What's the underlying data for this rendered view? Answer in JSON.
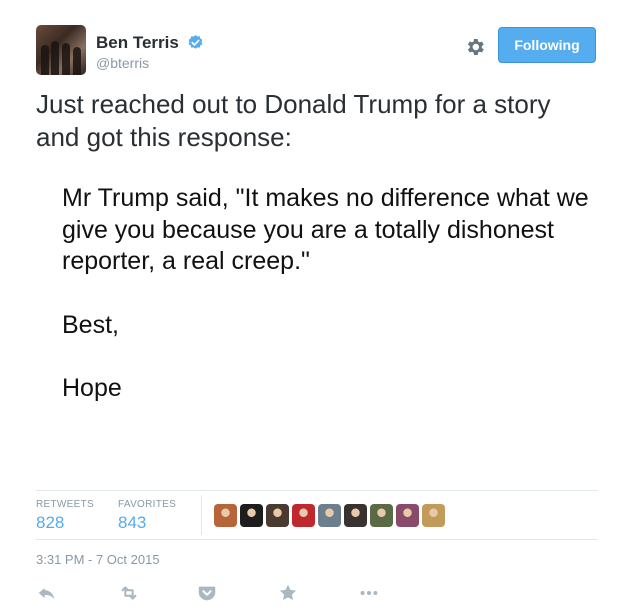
{
  "user": {
    "name": "Ben Terris",
    "handle": "@bterris",
    "verified": true
  },
  "follow_button": {
    "label": "Following",
    "color": "#55acee"
  },
  "tweet": {
    "text": "Just reached out to Donald Trump for a story and got this response:",
    "quote": {
      "line1": "Mr Trump said, \"It makes no difference what we give you because you are a totally dishonest reporter, a real creep.\"",
      "line2": "Best,",
      "line3": "Hope"
    }
  },
  "stats": {
    "retweets_label": "RETWEETS",
    "retweets_count": "828",
    "favorites_label": "FAVORITES",
    "favorites_count": "843"
  },
  "favoriter_avatars": [
    {
      "icon": "user-avatar",
      "color": "#b8643a"
    },
    {
      "icon": "user-avatar",
      "color": "#1d1d1d"
    },
    {
      "icon": "user-avatar",
      "color": "#4a3a30"
    },
    {
      "icon": "user-avatar",
      "color": "#c0282f"
    },
    {
      "icon": "user-avatar",
      "color": "#6b7f8e"
    },
    {
      "icon": "user-avatar",
      "color": "#3a3230"
    },
    {
      "icon": "user-avatar",
      "color": "#5a6a45"
    },
    {
      "icon": "user-avatar",
      "color": "#8a4a6a"
    },
    {
      "icon": "user-avatar",
      "color": "#c29a5a"
    }
  ],
  "timestamp": "3:31 PM - 7 Oct 2015",
  "actions": [
    "reply-icon",
    "retweet-icon",
    "pocket-icon",
    "favorite-icon",
    "more-icon"
  ],
  "colors": {
    "text": "#292f33",
    "muted": "#8899a6",
    "accent": "#55acee",
    "border": "#e1e8ed",
    "verified": "#55acee"
  }
}
